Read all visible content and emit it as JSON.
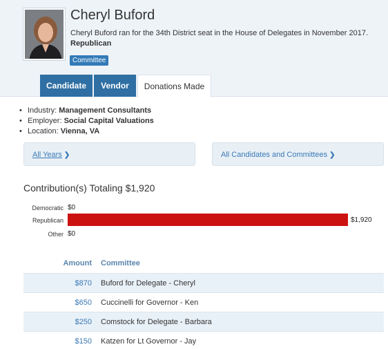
{
  "candidate": {
    "name": "Cheryl Buford",
    "description": "Cheryl Buford ran for the 34th District seat in the House of Delegates in November 2017.",
    "party": "Republican",
    "badge": "Committee"
  },
  "tabs": [
    {
      "label": "Candidate",
      "active": false
    },
    {
      "label": "Vendor",
      "active": false
    },
    {
      "label": "Donations Made",
      "active": true
    }
  ],
  "info": {
    "industry_label": "Industry:",
    "industry_value": "Management Consultants",
    "employer_label": "Employer:",
    "employer_value": "Social Capital Valuations",
    "location_label": "Location:",
    "location_value": "Vienna, VA"
  },
  "filters": {
    "years": "All Years",
    "candidates": "All Candidates and Committees"
  },
  "total_text": "Contribution(s) Totaling $1,920",
  "chart_data": {
    "type": "bar",
    "orientation": "horizontal",
    "categories": [
      "Democratic",
      "Republican",
      "Other"
    ],
    "values": [
      0,
      1920,
      0
    ],
    "value_labels": [
      "$0",
      "$1,920",
      "$0"
    ],
    "colors": {
      "Republican": "#cc1111"
    }
  },
  "table": {
    "headers": {
      "amount": "Amount",
      "committee": "Committee"
    },
    "rows": [
      {
        "amount": "$870",
        "committee": "Buford for Delegate - Cheryl"
      },
      {
        "amount": "$650",
        "committee": "Cuccinelli for Governor - Ken"
      },
      {
        "amount": "$250",
        "committee": "Comstock for Delegate - Barbara"
      },
      {
        "amount": "$150",
        "committee": "Katzen for Lt Governor - Jay"
      }
    ]
  }
}
